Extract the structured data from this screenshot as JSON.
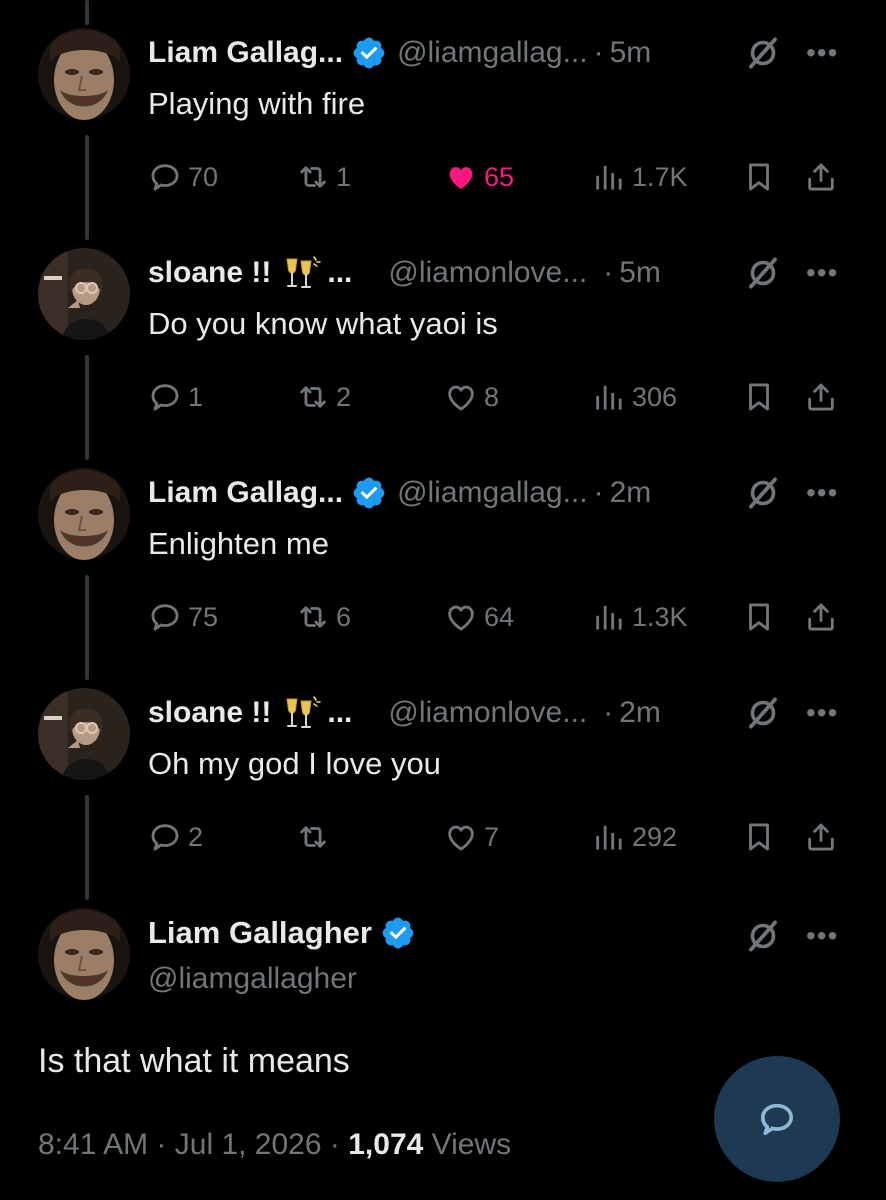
{
  "colors": {
    "background": "#000000",
    "text": "#e7e9ea",
    "muted": "#71767b",
    "like": "#f91880",
    "verified": "#1d9bf0",
    "fab": "#1d3a52"
  },
  "replies": [
    {
      "name": "Liam Gallag...",
      "verified": true,
      "emoji": "",
      "handle": "@liamgallag...",
      "time": "5m",
      "text": "Playing with fire",
      "reply_count": "70",
      "repost_count": "1",
      "like_count": "65",
      "liked": true,
      "view_count": "1.7K"
    },
    {
      "name": "sloane !!",
      "verified": false,
      "emoji": "clinking-glasses",
      "ellipsis": "...",
      "handle": "@liamonlove...",
      "time": "5m",
      "text": "Do you know what yaoi is",
      "reply_count": "1",
      "repost_count": "2",
      "like_count": "8",
      "liked": false,
      "view_count": "306"
    },
    {
      "name": "Liam Gallag...",
      "verified": true,
      "emoji": "",
      "handle": "@liamgallag...",
      "time": "2m",
      "text": "Enlighten me",
      "reply_count": "75",
      "repost_count": "6",
      "like_count": "64",
      "liked": false,
      "view_count": "1.3K"
    },
    {
      "name": "sloane !!",
      "verified": false,
      "emoji": "clinking-glasses",
      "ellipsis": "...",
      "handle": "@liamonlove...",
      "time": "2m",
      "text": "Oh my god I love you",
      "reply_count": "2",
      "repost_count": "",
      "like_count": "7",
      "liked": false,
      "view_count": "292"
    }
  ],
  "main_tweet": {
    "name": "Liam Gallagher",
    "verified": true,
    "handle": "@liamgallagher",
    "text": "Is that what it means",
    "time": "8:41 AM",
    "date": "Jul 1, 2026",
    "separator": "·",
    "views_count": "1,074",
    "views_label": "Views"
  },
  "icons": {
    "more": "more-dots-icon",
    "grok": "grok-icon",
    "reply": "reply-icon",
    "repost": "repost-icon",
    "like": "heart-icon",
    "views": "views-icon",
    "bookmark": "bookmark-icon",
    "share": "share-icon",
    "compose": "reply-fab-icon"
  },
  "ui": {
    "dot": "·",
    "more": "•••"
  }
}
